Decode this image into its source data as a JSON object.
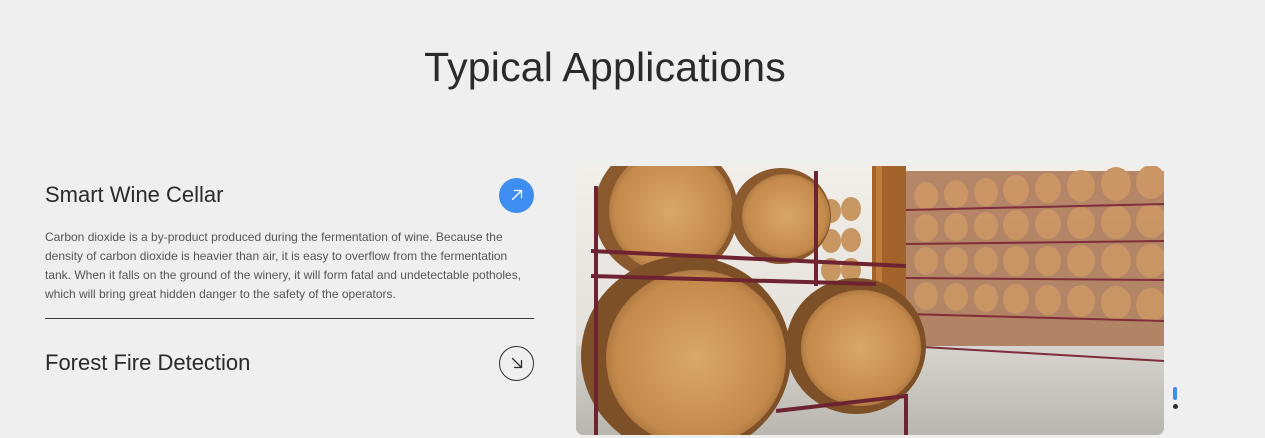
{
  "section": {
    "title": "Typical Applications"
  },
  "applications": [
    {
      "title": "Smart Wine Cellar",
      "expanded": true,
      "icon": "arrow-up-right-icon",
      "description": "Carbon dioxide is a by-product produced during the fermentation of wine. Because the density of carbon dioxide is heavier than air, it is easy to overflow from the fermentation tank. When it falls on the ground of the winery, it will form fatal and undetectable potholes, which will bring great hidden danger to the safety of the operators."
    },
    {
      "title": "Forest Fire Detection",
      "expanded": false,
      "icon": "arrow-down-right-icon"
    }
  ],
  "pagination": {
    "total": 2,
    "active_index": 0
  },
  "colors": {
    "background": "#efefef",
    "accent": "#3d8ef0",
    "text": "#2a2a2a"
  }
}
